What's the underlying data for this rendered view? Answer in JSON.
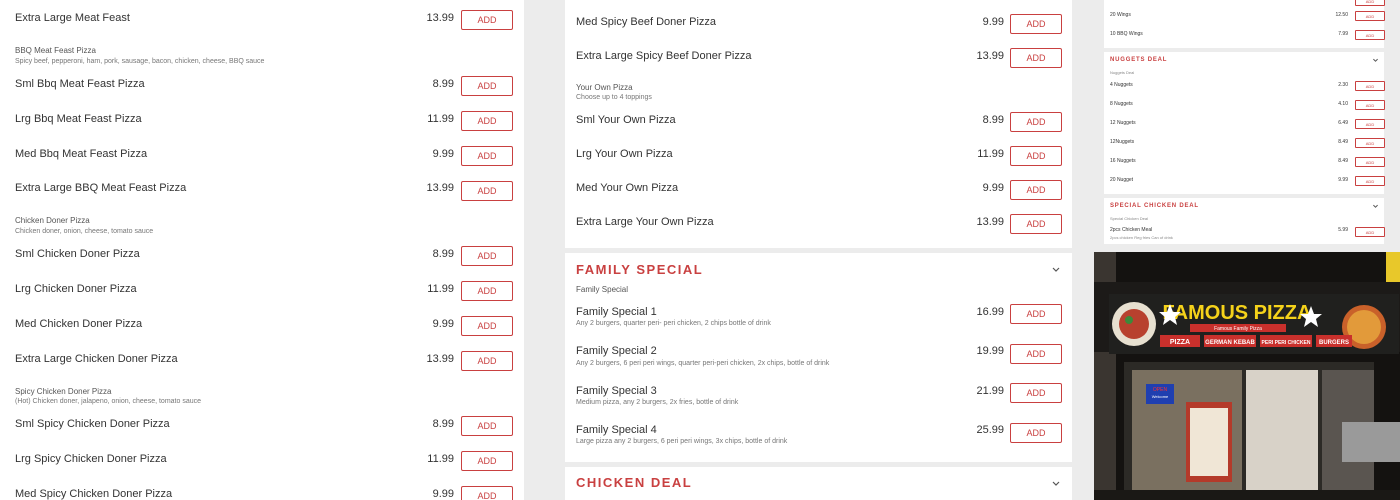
{
  "add_label": "ADD",
  "colors": {
    "accent": "#c94040",
    "background": "#ececec"
  },
  "col1": {
    "rows": [
      {
        "name": "Extra Large Meat Feast",
        "price": "13.99"
      },
      {
        "name": "Sml Bbq Meat Feast Pizza",
        "price": "8.99"
      },
      {
        "name": "Lrg Bbq Meat Feast Pizza",
        "price": "11.99"
      },
      {
        "name": "Med Bbq Meat Feast Pizza",
        "price": "9.99"
      },
      {
        "name": "Extra Large BBQ Meat Feast Pizza",
        "price": "13.99"
      },
      {
        "name": "Sml Chicken Doner Pizza",
        "price": "8.99"
      },
      {
        "name": "Lrg Chicken Doner Pizza",
        "price": "11.99"
      },
      {
        "name": "Med Chicken Doner Pizza",
        "price": "9.99"
      },
      {
        "name": "Extra Large Chicken Doner Pizza",
        "price": "13.99"
      },
      {
        "name": "Sml Spicy Chicken Doner Pizza",
        "price": "8.99"
      },
      {
        "name": "Lrg Spicy Chicken Doner Pizza",
        "price": "11.99"
      },
      {
        "name": "Med Spicy Chicken Doner Pizza",
        "price": "9.99"
      }
    ],
    "groups": [
      {
        "title": "BBQ Meat Feast Pizza",
        "desc": "Spicy beef, pepperoni, ham, pork, sausage, bacon, chicken, cheese, BBQ sauce"
      },
      {
        "title": "Chicken Doner Pizza",
        "desc": "Chicken doner, onion, cheese, tomato sauce"
      },
      {
        "title": "Spicy Chicken Doner Pizza",
        "desc": "(Hot) Chicken doner, jalapeno, onion, cheese, tomato sauce"
      }
    ]
  },
  "col2": {
    "rows_top": [
      {
        "name": "Med Spicy Beef Doner Pizza",
        "price": "9.99"
      },
      {
        "name": "Extra Large Spicy Beef Doner Pizza",
        "price": "13.99"
      },
      {
        "name": "Sml Your Own Pizza",
        "price": "8.99"
      },
      {
        "name": "Lrg Your Own Pizza",
        "price": "11.99"
      },
      {
        "name": "Med Your Own Pizza",
        "price": "9.99"
      },
      {
        "name": "Extra Large Your Own Pizza",
        "price": "13.99"
      }
    ],
    "group": {
      "title": "Your Own Pizza",
      "desc": "Choose up to 4 toppings"
    },
    "family": {
      "title": "FAMILY SPECIAL",
      "sub": "Family Special",
      "items": [
        {
          "name": "Family Special 1",
          "desc": "Any 2 burgers, quarter peri- peri chicken, 2 chips bottle of drink",
          "price": "16.99"
        },
        {
          "name": "Family Special 2",
          "desc": "Any 2 burgers, 6 peri peri wings, quarter peri-peri chicken, 2x chips, bottle of drink",
          "price": "19.99"
        },
        {
          "name": "Family Special 3",
          "desc": "Medium pizza, any 2 burgers, 2x fries, bottle of drink",
          "price": "21.99"
        },
        {
          "name": "Family Special 4",
          "desc": "Large pizza any 2 burgers, 6 peri peri wings, 3x chips, bottle of drink",
          "price": "25.99"
        }
      ]
    },
    "chicken_deal_title": "CHICKEN DEAL"
  },
  "col3": {
    "wings": [
      {
        "name": "20 Wings",
        "price": "12.50"
      },
      {
        "name": "10 BBQ Wings",
        "price": "7.99"
      }
    ],
    "nuggets": {
      "title": "NUGGETS DEAL",
      "sub": "Nuggets Deal",
      "items": [
        {
          "name": "4 Nuggets",
          "price": "2.30"
        },
        {
          "name": "8 Nuggets",
          "price": "4.10"
        },
        {
          "name": "12 Nuggets",
          "price": "6.49"
        },
        {
          "name": "12Nuggets",
          "price": "8.49"
        },
        {
          "name": "16 Nuggets",
          "price": "8.49"
        },
        {
          "name": "20 Nugget",
          "price": "9.99"
        }
      ]
    },
    "special": {
      "title": "SPECIAL CHICKEN DEAL",
      "sub": "Special Chicken Deal",
      "item": {
        "name": "2pcs Chicken Meal",
        "desc": "2pcs chicken Reg fries Can of drink",
        "price": "5.99"
      }
    },
    "photo": {
      "sign": "FAMOUS PIZZA",
      "sign_tag": "Famous Family Pizza",
      "menu_words": [
        "PIZZA",
        "GERMAN KEBAB",
        "PERI PERI CHICKEN",
        "BURGERS"
      ],
      "open_sign": "OPEN",
      "welcome": "Welcome"
    }
  }
}
